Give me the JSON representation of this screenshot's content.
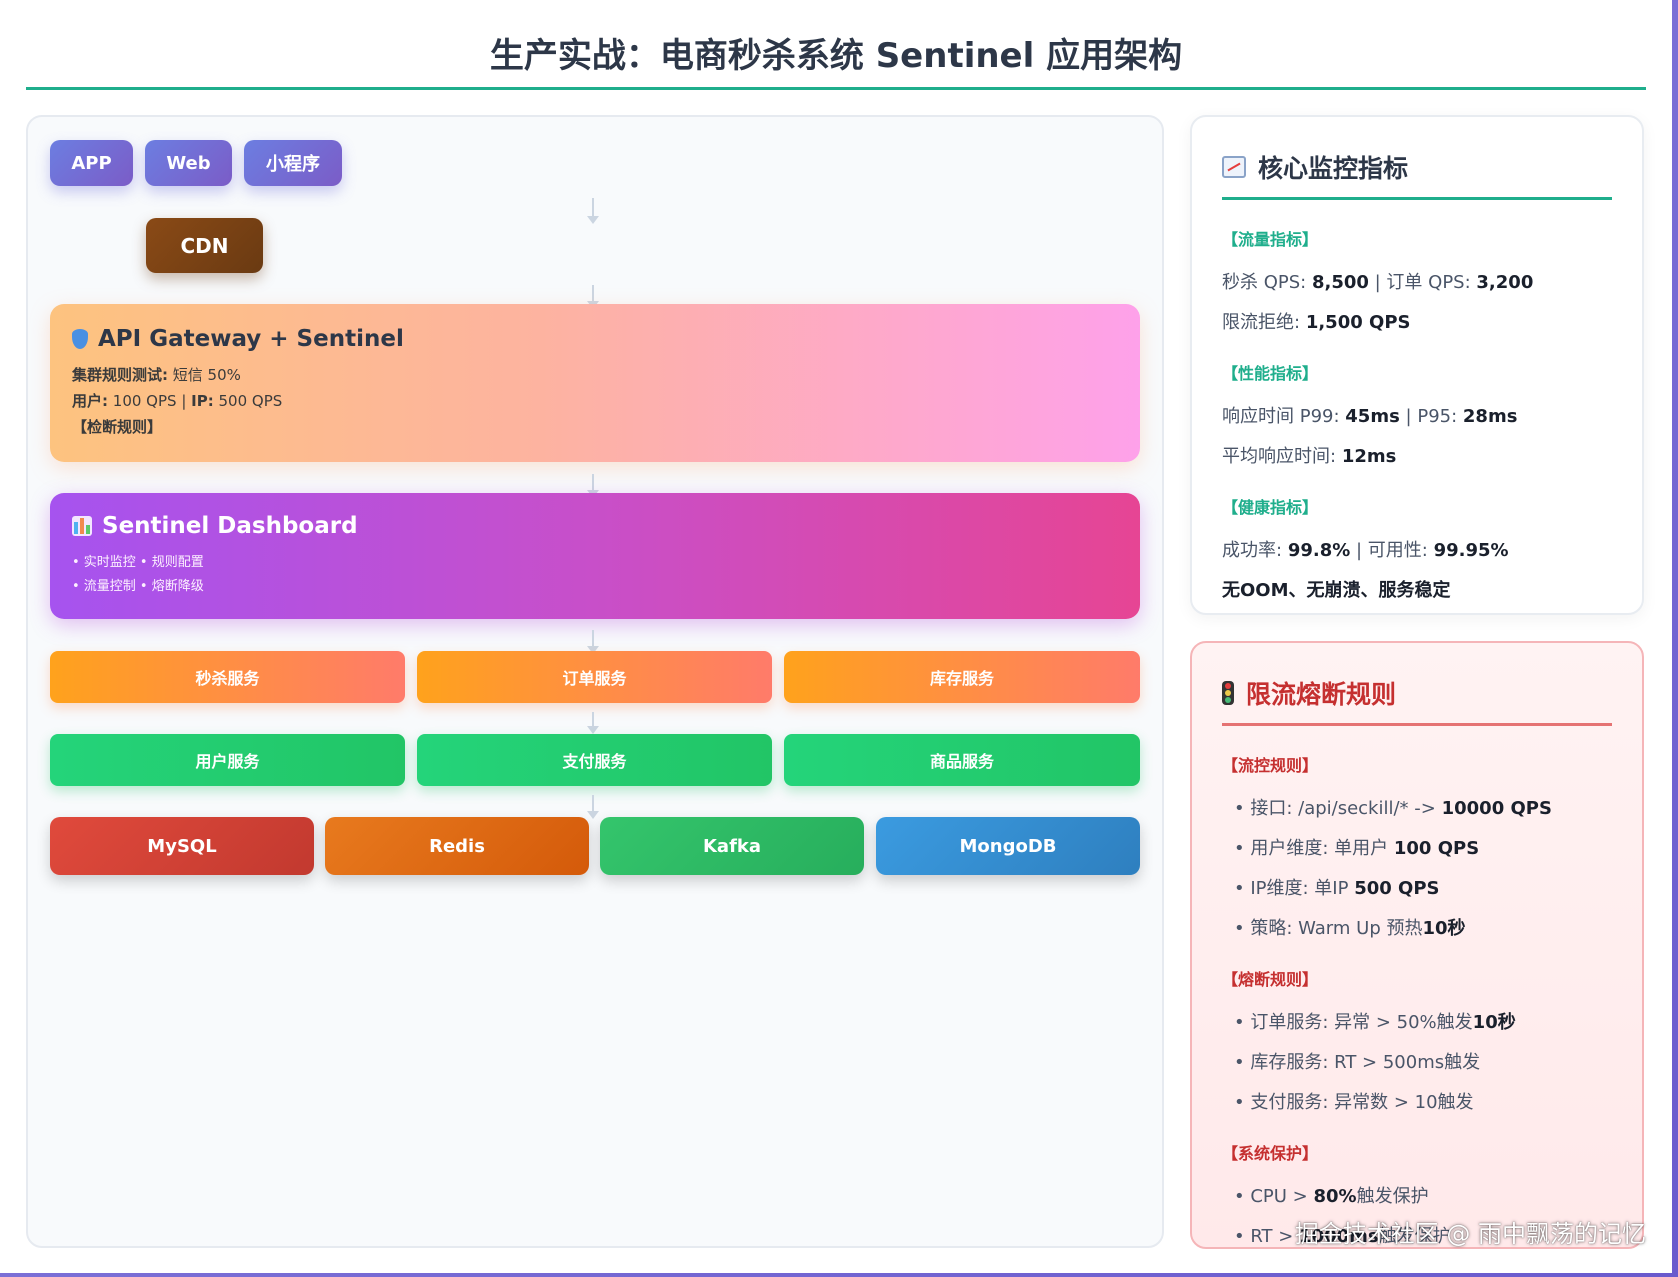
{
  "title": "生产实战：电商秒杀系统 Sentinel 应用架构",
  "clients": [
    "APP",
    "Web",
    "小程序"
  ],
  "cdn": "CDN",
  "gateway": {
    "title": "API Gateway + Sentinel",
    "line1_label": "集群规则测试:",
    "line1_value": "短信 50%",
    "line2_user_label": "用户:",
    "line2_user_value": "100 QPS |",
    "line2_ip_label": "IP:",
    "line2_ip_value": "500 QPS",
    "line3": "【检断规则】"
  },
  "dashboard": {
    "title": "Sentinel Dashboard",
    "line1": "• 实时监控 • 规则配置",
    "line2": "• 流量控制 • 熔断降级"
  },
  "services_row1": [
    "秒杀服务",
    "订单服务",
    "库存服务"
  ],
  "services_row2": [
    "用户服务",
    "支付服务",
    "商品服务"
  ],
  "databases": [
    {
      "name": "MySQL",
      "color": "#d6463a"
    },
    {
      "name": "Redis",
      "color": "#e26a16"
    },
    {
      "name": "Kafka",
      "color": "#2ebd62"
    },
    {
      "name": "MongoDB",
      "color": "#3a8fd6"
    }
  ],
  "metrics": {
    "title": "核心监控指标",
    "traffic": {
      "label": "【流量指标】",
      "seckill_label": "秒杀 QPS:",
      "seckill_value": "8,500",
      "order_label": "| 订单 QPS:",
      "order_value": "3,200",
      "reject_label": "限流拒绝:",
      "reject_value": "1,500 QPS"
    },
    "performance": {
      "label": "【性能指标】",
      "p99_label": "响应时间 P99:",
      "p99_value": "45ms",
      "p95_label": "| P95:",
      "p95_value": "28ms",
      "avg_label": "平均响应时间:",
      "avg_value": "12ms"
    },
    "health": {
      "label": "【健康指标】",
      "success_label": "成功率:",
      "success_value": "99.8%",
      "avail_label": "| 可用性:",
      "avail_value": "99.95%",
      "stable": "无OOM、无崩溃、服务稳定"
    }
  },
  "rules": {
    "title": "限流熔断规则",
    "flow": {
      "label": "【流控规则】",
      "r1_text": "• 接口: /api/seckill/* ->",
      "r1_value": "10000 QPS",
      "r2_text": "• 用户维度: 单用户",
      "r2_value": "100 QPS",
      "r3_text": "• IP维度: 单IP",
      "r3_value": "500 QPS",
      "r4_text": "• 策略: Warm Up 预热",
      "r4_value": "10秒"
    },
    "circuit": {
      "label": "【熔断规则】",
      "r1_text": "• 订单服务: 异常 > 50%触发",
      "r1_value": "10秒",
      "r2_text": "• 库存服务: RT > 500ms触发",
      "r3_text": "• 支付服务: 异常数 > 10触发"
    },
    "system": {
      "label": "【系统保护】",
      "r1_text": "• CPU >",
      "r1_value": "80%",
      "r1_suffix": "触发保护",
      "r2_text": "• RT >",
      "r2_value": "1000ms",
      "r2_suffix": "触发保护"
    }
  },
  "watermark": "掘金技术社区 @ 雨中飘荡的记忆",
  "colors": {
    "accent": "#1fae8c",
    "danger": "#c53030"
  }
}
